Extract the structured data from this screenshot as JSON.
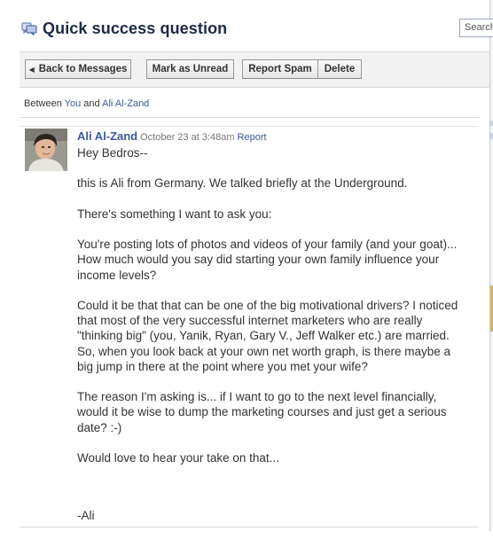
{
  "window": {
    "title": "Quick success question"
  },
  "search": {
    "placeholder": "Search"
  },
  "toolbar": {
    "back_label": "Back to Messages",
    "mark_unread_label": "Mark as Unread",
    "report_spam_label": "Report Spam",
    "delete_label": "Delete"
  },
  "participants": {
    "prefix": "Between",
    "you": "You",
    "and": "and",
    "other": "Ali Al-Zand"
  },
  "message": {
    "sender": "Ali Al-Zand",
    "date": "October 23 at 3:48am",
    "report_label": "Report",
    "paragraphs": [
      "Hey Bedros--",
      "this is Ali from Germany. We talked briefly at the Underground.",
      "There's something I want to ask you:",
      "You're posting lots of photos and videos of your family (and your goat)... How much would you say did starting your own family influence your income levels?",
      "Could it be that that can be one of the big motivational drivers? I noticed that most of the very successful internet marketers who are really \"thinking big\" (you, Yanik, Ryan, Gary V., Jeff Walker etc.) are married. So, when you look back at your own net worth graph, is there maybe a big jump in there at the point where you met your wife?",
      "The reason I'm asking is... if I want to go to the next level financially, would it be wise to dump the marketing courses and just get a serious date? :-)",
      "Would love to hear your take on that...",
      "-Ali"
    ]
  },
  "colors": {
    "link": "#3b5998",
    "title": "#1c2a47",
    "toolbar_bg": "#f2f2f2"
  },
  "icons": {
    "title_icon": "message-icon",
    "back_icon": "left-triangle-icon"
  }
}
